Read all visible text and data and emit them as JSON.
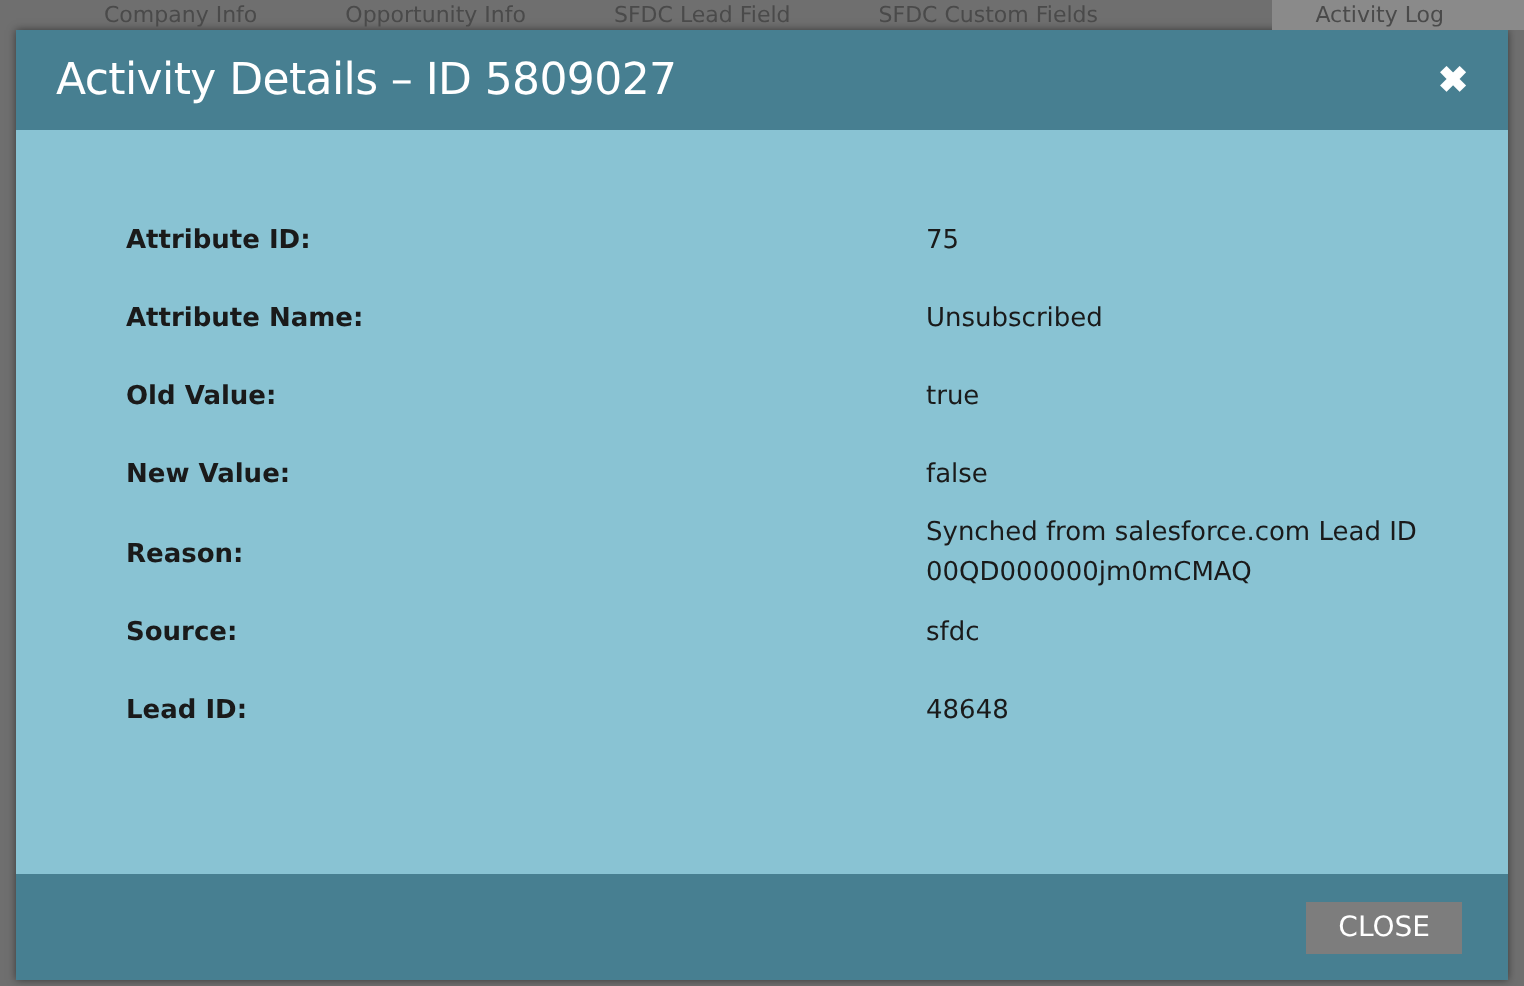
{
  "background_tabs": [
    {
      "label": "Company Info",
      "selected": false
    },
    {
      "label": "Opportunity Info",
      "selected": false
    },
    {
      "label": "SFDC Lead Field",
      "selected": false
    },
    {
      "label": "SFDC Custom Fields",
      "selected": false
    },
    {
      "label": "Activity Log",
      "selected": true
    }
  ],
  "dialog": {
    "title": "Activity Details – ID 5809027",
    "close_icon": "✖",
    "fields": [
      {
        "label": "Attribute ID:",
        "value": "75"
      },
      {
        "label": "Attribute Name:",
        "value": "Unsubscribed"
      },
      {
        "label": "Old Value:",
        "value": "true"
      },
      {
        "label": "New Value:",
        "value": "false"
      },
      {
        "label": "Reason:",
        "value": "Synched from salesforce.com Lead ID 00QD000000jm0mCMAQ"
      },
      {
        "label": "Source:",
        "value": "sfdc"
      },
      {
        "label": "Lead ID:",
        "value": "48648"
      }
    ],
    "buttons": [
      "CLOSE"
    ]
  }
}
